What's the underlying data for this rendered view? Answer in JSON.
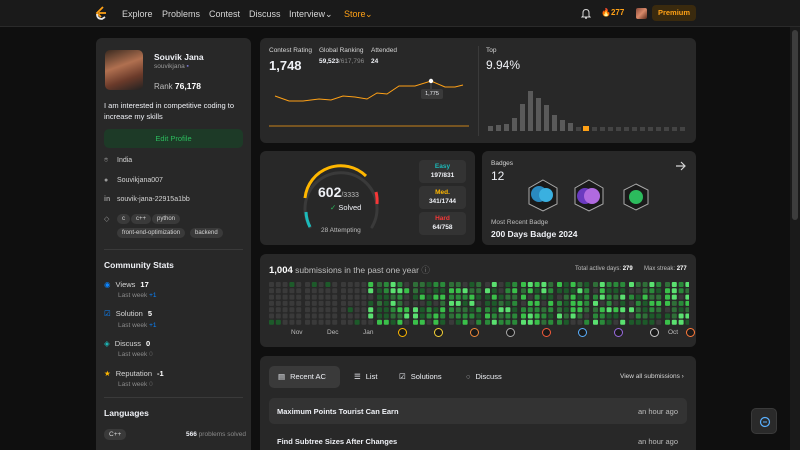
{
  "nav": {
    "items": [
      "Explore",
      "Problems",
      "Contest",
      "Discuss",
      "Interview",
      "Store"
    ],
    "streak": "277",
    "premium": "Premium"
  },
  "profile": {
    "name": "Souvik Jana",
    "handle": "souvikjana",
    "rank_label": "Rank",
    "rank_value": "76,178",
    "bio": "I am interested in competitive coding to increase my skills",
    "edit_label": "Edit Profile",
    "location": "India",
    "github": "Souvikjana007",
    "linkedin": "souvik-jana-22915a1bb",
    "tags": [
      "c",
      "c++",
      "python",
      "front-end-optimization",
      "backend"
    ]
  },
  "community": {
    "title": "Community Stats",
    "stats": [
      {
        "label": "Views",
        "value": "17",
        "sub": "Last week",
        "delta": "+1"
      },
      {
        "label": "Solution",
        "value": "5",
        "sub": "Last week",
        "delta": "+1"
      },
      {
        "label": "Discuss",
        "value": "0",
        "sub": "Last week",
        "delta": "0"
      },
      {
        "label": "Reputation",
        "value": "-1",
        "sub": "Last week",
        "delta": "0"
      }
    ]
  },
  "languages": {
    "title": "Languages",
    "items": [
      {
        "name": "C++",
        "count": "566",
        "suffix": "problems solved"
      }
    ]
  },
  "contest": {
    "rating_label": "Contest Rating",
    "rating": "1,748",
    "global_label": "Global Ranking",
    "global_rank": "59,523",
    "global_total": "/617,796",
    "attended_label": "Attended",
    "attended": "24",
    "tooltip": "1,775",
    "top_label": "Top",
    "top_value": "9.94%"
  },
  "solved": {
    "count": "602",
    "total": "/3333",
    "label": "Solved",
    "attempting": "28 Attempting",
    "easy": {
      "label": "Easy",
      "value": "197/831"
    },
    "medium": {
      "label": "Med.",
      "value": "341/1744"
    },
    "hard": {
      "label": "Hard",
      "value": "64/758"
    }
  },
  "badges": {
    "label": "Badges",
    "count": "12",
    "recent_label": "Most Recent Badge",
    "recent_name": "200 Days Badge 2024"
  },
  "submissions": {
    "count": "1,004",
    "text": "submissions in the past one year",
    "active_label": "Total active days:",
    "active": "279",
    "streak_label": "Max streak:",
    "streak": "277",
    "months": [
      "Nov",
      "Dec",
      "Jan",
      "Oct"
    ]
  },
  "recent": {
    "tabs": [
      "Recent AC",
      "List",
      "Solutions",
      "Discuss"
    ],
    "view_all": "View all submissions",
    "rows": [
      {
        "title": "Maximum Points Tourist Can Earn",
        "time": "an hour ago"
      },
      {
        "title": "Find Subtree Sizes After Changes",
        "time": "an hour ago"
      }
    ]
  },
  "colors": {
    "accent": "#ffa116",
    "easy": "#1cbaba",
    "medium": "#ffb700",
    "hard": "#f63737",
    "green": "#2cbb5d"
  }
}
